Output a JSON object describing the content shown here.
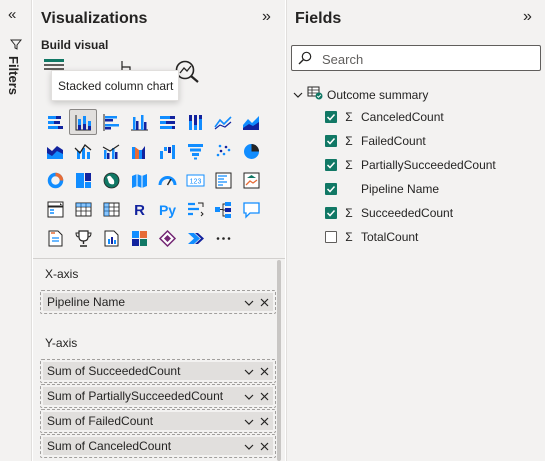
{
  "filters": {
    "label": "Filters",
    "expand_glyph": "«"
  },
  "visualizations": {
    "title": "Visualizations",
    "collapse_glyph": "»",
    "build_visual_label": "Build visual",
    "tooltip": "Stacked column chart",
    "selected_index": 1,
    "visual_icons": [
      "stacked-bar-chart-icon",
      "stacked-column-chart-icon",
      "clustered-bar-chart-icon",
      "clustered-column-chart-icon",
      "100-stacked-bar-chart-icon",
      "100-stacked-column-chart-icon",
      "line-chart-icon",
      "area-chart-icon",
      "stacked-area-chart-icon",
      "line-and-stacked-column-icon",
      "line-and-clustered-column-icon",
      "ribbon-chart-icon",
      "waterfall-chart-icon",
      "funnel-chart-icon",
      "scatter-chart-icon",
      "pie-chart-icon",
      "donut-chart-icon",
      "treemap-icon",
      "map-icon",
      "filled-map-icon",
      "gauge-icon",
      "card-icon",
      "multi-row-card-icon",
      "kpi-icon",
      "slicer-icon",
      "table-icon",
      "matrix-icon",
      "r-visual-icon",
      "python-visual-icon",
      "key-influencers-icon",
      "decomposition-tree-icon",
      "qa-icon",
      "smart-narrative-icon",
      "trophy-icon",
      "paginated-report-icon",
      "power-apps-icon",
      "power-automate-icon",
      "power-automate-flow-icon",
      "more-visuals-icon"
    ],
    "xaxis": {
      "label": "X-axis",
      "fields": [
        "Pipeline Name"
      ]
    },
    "yaxis": {
      "label": "Y-axis",
      "fields": [
        "Sum of SucceededCount",
        "Sum of PartiallySucceededCount",
        "Sum of FailedCount",
        "Sum of CanceledCount"
      ]
    }
  },
  "fields": {
    "title": "Fields",
    "collapse_glyph": "»",
    "search_placeholder": "Search",
    "table_name": "Outcome summary",
    "items": [
      {
        "name": "CanceledCount",
        "checked": true,
        "sigma": true
      },
      {
        "name": "FailedCount",
        "checked": true,
        "sigma": true
      },
      {
        "name": "PartiallySucceededCount",
        "checked": true,
        "sigma": true
      },
      {
        "name": "Pipeline Name",
        "checked": true,
        "sigma": false
      },
      {
        "name": "SucceededCount",
        "checked": true,
        "sigma": true
      },
      {
        "name": "TotalCount",
        "checked": false,
        "sigma": true
      }
    ]
  },
  "colors": {
    "pane_bg": "#f3f2f1",
    "accent_green": "#117865",
    "icon_blue": "#118dff",
    "border": "#e1dfdd"
  }
}
